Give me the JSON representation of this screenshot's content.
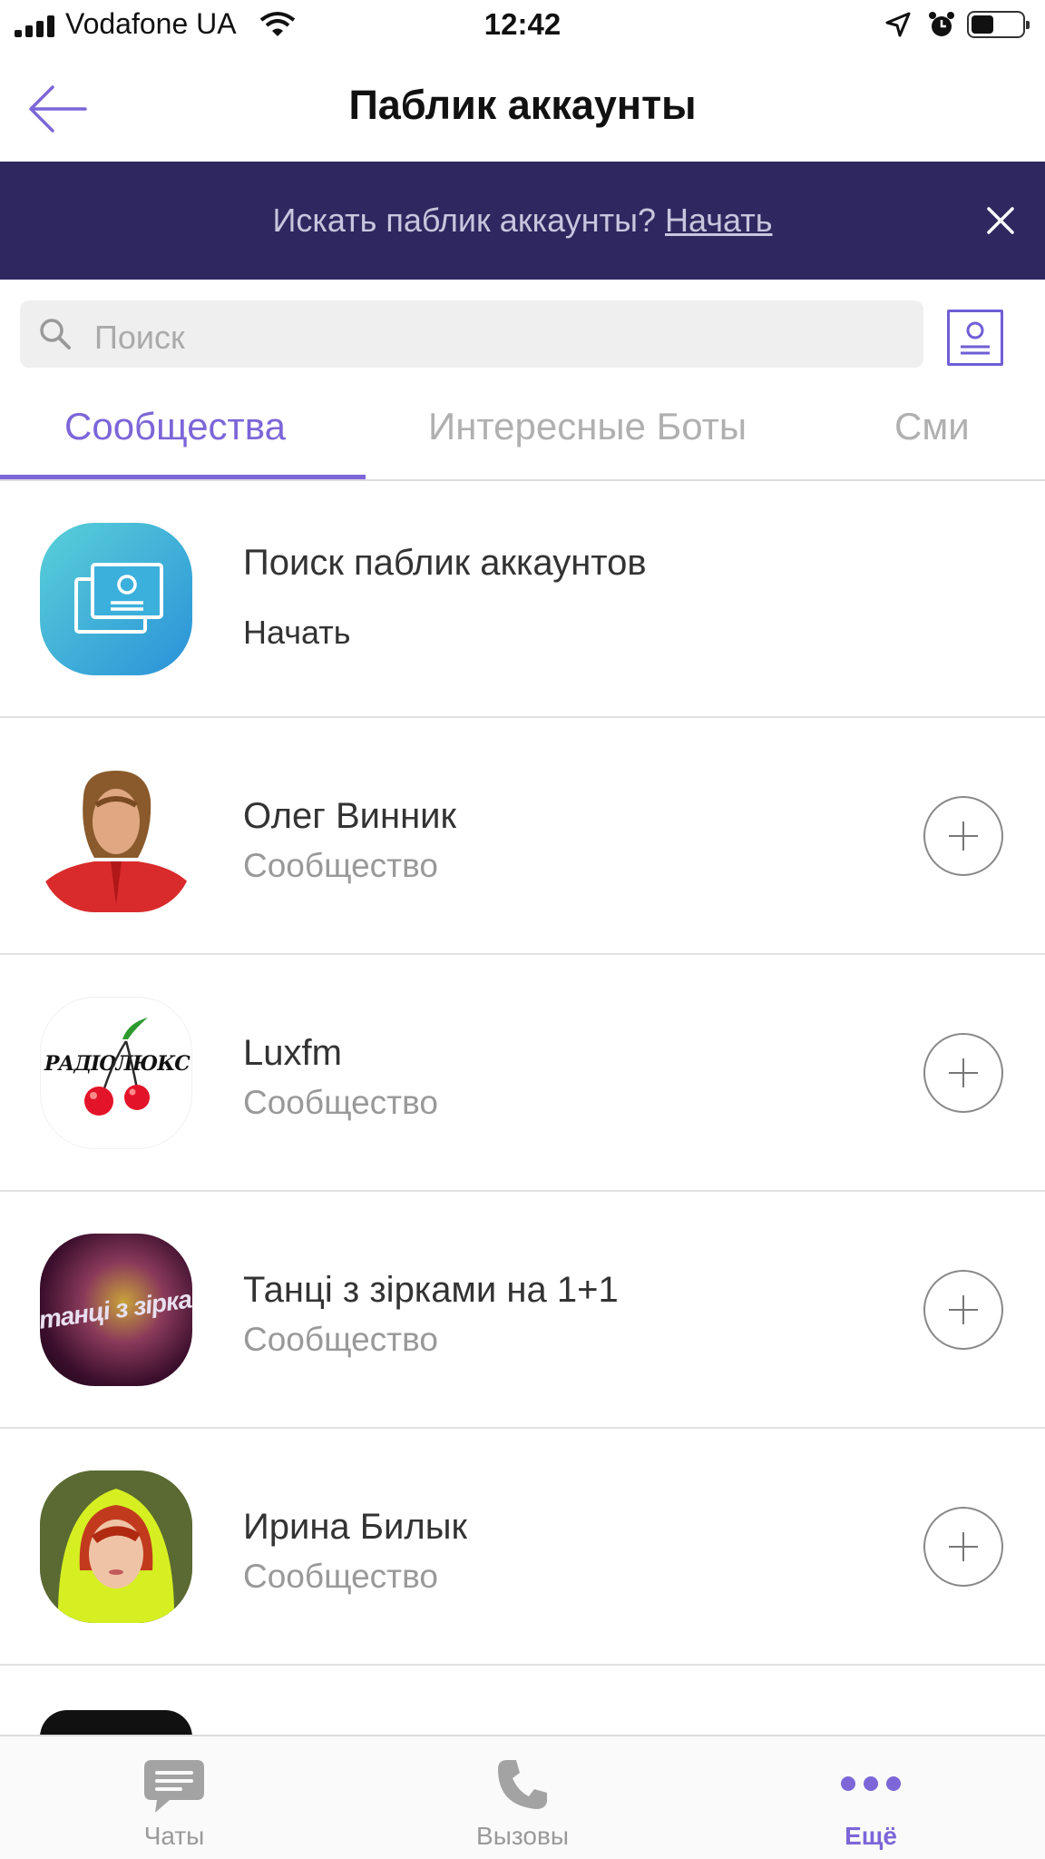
{
  "status_bar": {
    "carrier": "Vodafone UA",
    "time": "12:42",
    "icons": [
      "signal-icon",
      "wifi-icon",
      "location-icon",
      "alarm-icon",
      "battery-icon"
    ]
  },
  "header": {
    "title": "Паблик аккаунты",
    "back_icon": "arrow-left-icon"
  },
  "banner": {
    "text": "Искать паблик аккаунты?",
    "link": "Начать",
    "close_icon": "close-icon",
    "background": "#2f2860"
  },
  "search": {
    "placeholder": "Поиск",
    "icon": "search-icon",
    "id_button_icon": "id-card-icon"
  },
  "tabs": [
    {
      "label": "Сообщества",
      "active": true
    },
    {
      "label": "Интересные Боты",
      "active": false
    },
    {
      "label": "Сми",
      "active": false
    }
  ],
  "accent_color": "#7c66d8",
  "list": [
    {
      "title": "Поиск паблик аккаунтов",
      "subtitle": "Начать",
      "icon": "public-accounts-search-icon"
    },
    {
      "title": "Олег Винник",
      "subtitle": "Сообщество",
      "icon": "avatar-photo"
    },
    {
      "title": "Luxfm",
      "subtitle": "Сообщество",
      "icon": "radio-lux-logo",
      "logo_text": "РАДІОЛЮКС"
    },
    {
      "title": "Танці з зірками на 1+1",
      "subtitle": "Сообщество",
      "icon": "tantsi-logo",
      "logo_text": "танці з зірками"
    },
    {
      "title": "Ирина Билык",
      "subtitle": "Сообщество",
      "icon": "avatar-photo"
    }
  ],
  "tabbar": [
    {
      "label": "Чаты",
      "icon": "chat-bubble-icon",
      "active": false
    },
    {
      "label": "Вызовы",
      "icon": "phone-icon",
      "active": false
    },
    {
      "label": "Ещё",
      "icon": "more-dots-icon",
      "active": true
    }
  ]
}
